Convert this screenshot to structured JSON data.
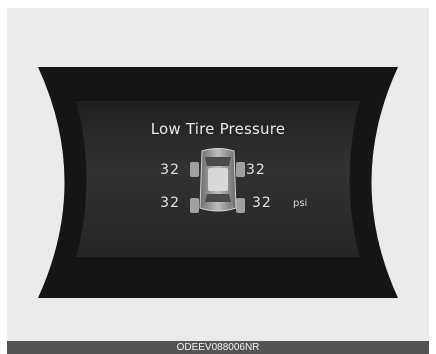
{
  "display": {
    "title": "Low Tire Pressure",
    "front_left": "32",
    "front_right": "32",
    "rear_left": "32",
    "rear_right": "32",
    "unit": "psi"
  },
  "icons": {
    "vehicle": "car-top-view-icon"
  },
  "footer": {
    "code": "ODEEV088006NR"
  },
  "colors": {
    "panel_background": "#ebebeb",
    "display_bezel": "#151515",
    "display_center": "#2a2a2a",
    "text": "#e9e9e9",
    "footer_background": "#555555"
  }
}
